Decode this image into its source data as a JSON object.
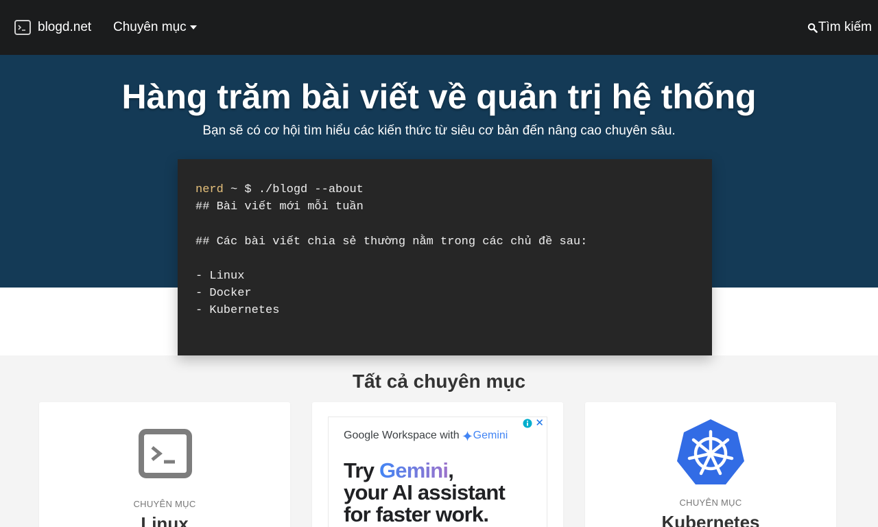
{
  "navbar": {
    "brand": "blogd.net",
    "menu_label": "Chuyên mục",
    "search_label": "Tìm kiếm"
  },
  "hero": {
    "title": "Hàng trăm bài viết về quản trị hệ thống",
    "subtitle": "Bạn sẽ có cơ hội tìm hiểu các kiến thức từ siêu cơ bản đến nâng cao chuyên sâu."
  },
  "terminal": {
    "prompt_user": "nerd",
    "prompt_rest": " ~ $ ./blogd --about",
    "lines": [
      "## Bài viết mới mỗi tuần",
      "",
      "## Các bài viết chia sẻ thường nằm trong các chủ đề sau:",
      "",
      "- Linux",
      "- Docker",
      "- Kubernetes"
    ]
  },
  "categories": {
    "title": "Tất cả chuyên mục",
    "cards": [
      {
        "kicker": "CHUYÊN MỤC",
        "name": "Linux",
        "icon": "terminal-icon"
      },
      {
        "kicker": "CHUYÊN MỤC",
        "name": "Kubernetes",
        "icon": "kubernetes-icon"
      }
    ]
  },
  "ad": {
    "header_prefix": "Google Workspace with",
    "header_brand": "Gemini",
    "line1_prefix": "Try ",
    "line1_brand": "Gemini",
    "line1_suffix": ",",
    "line2": "your AI assistant",
    "line3": "for faster work.",
    "close_glyph": "✕"
  },
  "colors": {
    "navbar": "#1b1c1d",
    "hero": "#143a56",
    "terminal": "#262626",
    "prompt": "#e5c07b",
    "kubernetes": "#326ce5"
  }
}
